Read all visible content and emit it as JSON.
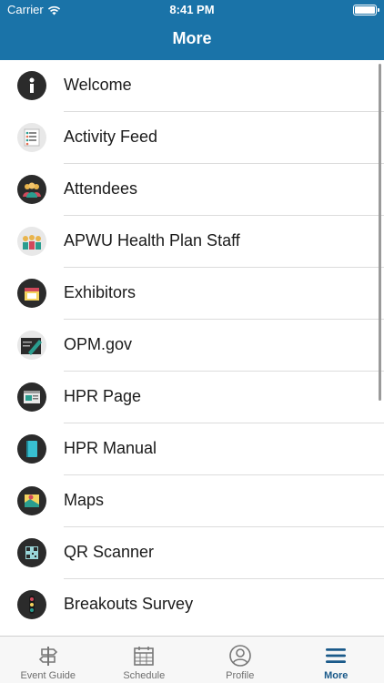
{
  "status_bar": {
    "carrier": "Carrier",
    "time": "8:41 PM"
  },
  "nav": {
    "title": "More"
  },
  "menu": {
    "items": [
      {
        "label": "Welcome",
        "icon": "info-icon"
      },
      {
        "label": "Activity Feed",
        "icon": "activity-feed-icon"
      },
      {
        "label": "Attendees",
        "icon": "attendees-icon"
      },
      {
        "label": "APWU Health Plan Staff",
        "icon": "staff-icon"
      },
      {
        "label": "Exhibitors",
        "icon": "exhibitors-icon"
      },
      {
        "label": "OPM.gov",
        "icon": "pen-document-icon"
      },
      {
        "label": "HPR Page",
        "icon": "web-page-icon"
      },
      {
        "label": "HPR Manual",
        "icon": "manual-icon"
      },
      {
        "label": "Maps",
        "icon": "map-icon"
      },
      {
        "label": "QR Scanner",
        "icon": "qr-code-icon"
      },
      {
        "label": "Breakouts Survey",
        "icon": "survey-icon"
      }
    ]
  },
  "tabbar": {
    "tabs": [
      {
        "label": "Event Guide",
        "icon": "signpost-icon",
        "active": false
      },
      {
        "label": "Schedule",
        "icon": "calendar-icon",
        "active": false
      },
      {
        "label": "Profile",
        "icon": "profile-icon",
        "active": false
      },
      {
        "label": "More",
        "icon": "menu-icon",
        "active": true
      }
    ]
  },
  "colors": {
    "header": "#1a73a8",
    "active_tab": "#1a5a8a",
    "icon_bg": "#2b2b2b"
  }
}
